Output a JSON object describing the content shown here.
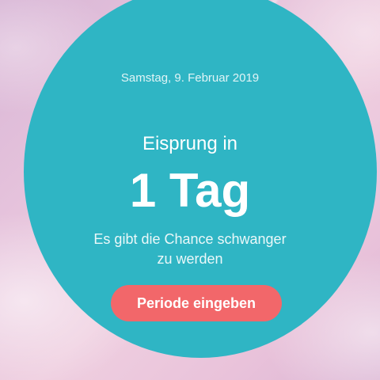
{
  "header": {
    "date": "Samstag, 9. Februar 2019"
  },
  "cycle": {
    "status_label": "Eisprung in",
    "countdown": "1 Tag",
    "chance_line1": "Es gibt die Chance schwanger",
    "chance_line2": "zu werden"
  },
  "actions": {
    "enter_period_label": "Periode eingeben"
  },
  "colors": {
    "circle": "#2fb5c4",
    "button": "#f2676a",
    "background": "#e6c3dc"
  }
}
